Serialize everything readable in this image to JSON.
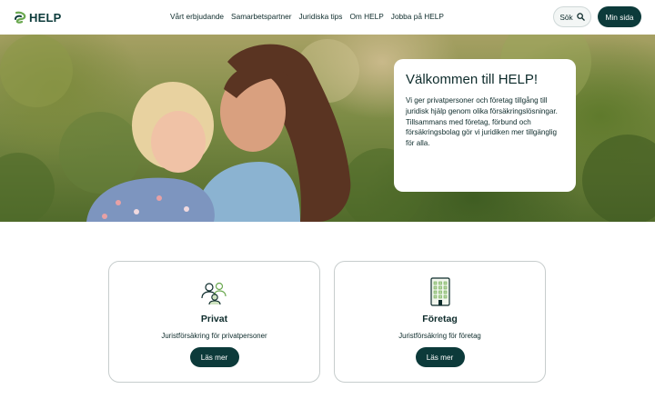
{
  "brand": {
    "name": "HELP",
    "accent": "#0c3a3a",
    "logo_green": "#6aa84f"
  },
  "nav": {
    "items": [
      {
        "label": "Vårt erbjudande"
      },
      {
        "label": "Samarbetspartner"
      },
      {
        "label": "Juridiska tips"
      },
      {
        "label": "Om HELP"
      },
      {
        "label": "Jobba på HELP"
      }
    ],
    "search_label": "Sök",
    "search_icon": "search-icon",
    "minsida_label": "Min sida"
  },
  "hero": {
    "image": "photo of woman holding a toddler outdoors",
    "title": "Välkommen till HELP!",
    "text": "Vi ger privatpersoner och företag tillgång till juridisk hjälp genom olika försäkringslösningar. Tillsammans med företag, förbund och försäkringsbolag gör vi juridiken mer tillgänglig för alla."
  },
  "cards": [
    {
      "icon": "people-icon",
      "title": "Privat",
      "subtitle": "Juristförsäkring för privatpersoner",
      "button": "Läs mer"
    },
    {
      "icon": "building-icon",
      "title": "Företag",
      "subtitle": "Juristförsäkring för företag",
      "button": "Läs mer"
    }
  ]
}
